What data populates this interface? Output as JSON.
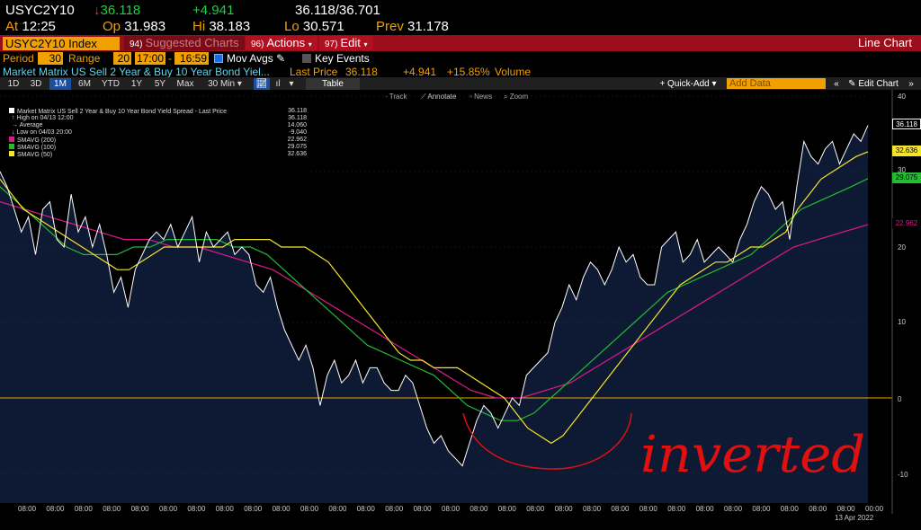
{
  "quote": {
    "ticker": "USYC2Y10",
    "last": "36.118",
    "change": "+4.941",
    "last_range": "36.118/36.701",
    "at_label": "At",
    "time": "12:25",
    "open_label": "Op",
    "open": "31.983",
    "high_label": "Hi",
    "high": "38.183",
    "low_label": "Lo",
    "low": "30.571",
    "prev_label": "Prev",
    "prev": "31.178"
  },
  "command_bar": {
    "security": "USYC2Y10 Index",
    "suggested_num": "94)",
    "suggested": "Suggested Charts",
    "actions_num": "96)",
    "actions": "Actions",
    "edit_num": "97)",
    "edit": "Edit",
    "title": "Line Chart"
  },
  "settings": {
    "period_label": "Period",
    "period_value": "30",
    "range_label": "Range",
    "range_value": "20",
    "time_from": "17:00",
    "time_to": "16:59",
    "mov_avgs": "Mov Avgs",
    "key_events": "Key Events"
  },
  "info": {
    "name": "Market Matrix US Sell 2 Year & Buy 10 Year Bond Yiel...",
    "last_price_label": "Last Price",
    "last_price": "36.118",
    "change": "+4.941",
    "pct_change": "+15.85%",
    "volume_label": "Volume"
  },
  "toolbar": {
    "ranges": [
      "1D",
      "3D",
      "1M",
      "6M",
      "YTD",
      "1Y",
      "5Y",
      "Max"
    ],
    "selected_range": "1M",
    "interval": "30 Min",
    "table": "Table",
    "quick_add": "+ Quick-Add",
    "add_data_placeholder": "Add Data",
    "edit_chart": "Edit Chart"
  },
  "annotate_bar": {
    "track": "Track",
    "annotate": "Annotate",
    "news": "News",
    "zoom": "Zoom"
  },
  "legend": {
    "title": "Market Matrix US Sell 2 Year & Buy 10 Year Bond Yield Spread - Last Price",
    "title_value": "36.118",
    "rows": [
      {
        "label": "High on 04/13 12:00",
        "value": "36.118",
        "color": ""
      },
      {
        "label": "Average",
        "value": "14.060",
        "color": ""
      },
      {
        "label": "Low on 04/03 20:00",
        "value": "-9.040",
        "color": ""
      },
      {
        "label": "SMAVG (200)",
        "value": "22.962",
        "color": "#e0198c"
      },
      {
        "label": "SMAVG (100)",
        "value": "29.075",
        "color": "#22bb33"
      },
      {
        "label": "SMAVG (50)",
        "value": "32.636",
        "color": "#f5e52a"
      }
    ]
  },
  "axis": {
    "y_ticks": [
      "40",
      "30",
      "20",
      "10",
      "0",
      "-10"
    ],
    "x_ticks": [
      "08:00",
      "08:00",
      "08:00",
      "08:00",
      "08:00",
      "08:00",
      "08:00",
      "08:00",
      "08:00",
      "08:00",
      "08:00",
      "08:00",
      "08:00",
      "08:00",
      "08:00",
      "08:00",
      "08:00",
      "08:00",
      "08:00",
      "08:00",
      "08:00",
      "08:00",
      "08:00",
      "08:00",
      "08:00",
      "08:00",
      "08:00",
      "08:00",
      "08:00",
      "08:00",
      "00:00"
    ],
    "date_label": "13 Apr 2022",
    "tag_last": "36.118",
    "tag_sma50": "32.636",
    "tag_sma100": "29.075",
    "tag_sma200": "22.962",
    "tag_sma50_color": "#f5e52a",
    "tag_sma100_color": "#22bb33",
    "tag_sma200_color": "#e0198c"
  },
  "annotation": {
    "text": "inverted",
    "color": "#e01010"
  },
  "chart_data": {
    "type": "line",
    "ylim": [
      -13,
      41
    ],
    "zero_line_color": "#f0a000",
    "series": [
      {
        "name": "Market Matrix US Sell 2 Year & Buy 10 Year Bond Yield Spread - Last Price",
        "color": "#ffffff",
        "values": [
          30,
          28,
          25,
          22,
          24,
          19,
          25,
          26,
          21,
          20,
          27,
          22,
          24,
          20,
          23,
          19,
          14,
          16,
          12,
          17,
          19,
          21,
          22,
          21,
          23,
          20,
          22,
          24,
          18,
          22,
          20,
          21,
          22,
          19,
          20,
          19,
          15,
          14,
          16,
          12,
          9,
          7,
          5,
          7,
          4,
          -1,
          3,
          5,
          2,
          3,
          5,
          2,
          4,
          4,
          2,
          1,
          1,
          3,
          2,
          -1,
          -4,
          -6,
          -5,
          -7,
          -8,
          -9,
          -6,
          -3,
          -1,
          -2,
          -4,
          -2,
          0,
          -1,
          3,
          4,
          5,
          6,
          10,
          12,
          15,
          13,
          16,
          18,
          17,
          15,
          17,
          20,
          18,
          19,
          16,
          15,
          15,
          20,
          21,
          22,
          18,
          19,
          21,
          18,
          19,
          20,
          19,
          18,
          21,
          23,
          26,
          28,
          27,
          25,
          26,
          21,
          28,
          34,
          32,
          31,
          33,
          34,
          31,
          33,
          35,
          34,
          36.118
        ]
      },
      {
        "name": "SMAVG (50)",
        "color": "#f5e52a",
        "values": [
          29,
          27,
          25,
          24,
          23,
          22,
          21,
          20,
          19,
          18,
          17,
          17,
          18,
          19,
          20,
          20,
          20,
          20,
          20,
          20,
          21,
          21,
          21,
          21,
          20,
          20,
          20,
          19,
          18,
          16,
          14,
          12,
          10,
          8,
          6,
          5,
          5,
          4,
          4,
          4,
          3,
          2,
          1,
          0,
          -2,
          -4,
          -5,
          -6,
          -5,
          -3,
          -1,
          1,
          3,
          5,
          7,
          9,
          11,
          13,
          15,
          16,
          17,
          18,
          18,
          19,
          20,
          20,
          21,
          22,
          25,
          27,
          29,
          30,
          31,
          32,
          32.636
        ]
      },
      {
        "name": "SMAVG (100)",
        "color": "#22bb33",
        "values": [
          28,
          26,
          24,
          22,
          20,
          19,
          19,
          19,
          20,
          20,
          21,
          21,
          21,
          21,
          20,
          20,
          19,
          17,
          15,
          13,
          11,
          9,
          7,
          6,
          5,
          4,
          3,
          1,
          -1,
          -2,
          -3,
          -3,
          -2,
          0,
          2,
          4,
          6,
          8,
          10,
          12,
          14,
          15,
          16,
          17,
          18,
          19,
          21,
          23,
          25,
          26,
          27,
          28,
          29.075
        ]
      },
      {
        "name": "SMAVG (200)",
        "color": "#e0198c",
        "values": [
          26,
          25,
          24,
          23,
          22,
          21,
          21,
          20,
          20,
          19,
          18,
          17,
          15,
          13,
          11,
          9,
          7,
          5,
          3,
          1,
          0,
          0,
          1,
          2,
          4,
          6,
          8,
          10,
          12,
          14,
          16,
          18,
          20,
          21,
          22,
          22.962
        ]
      }
    ]
  }
}
